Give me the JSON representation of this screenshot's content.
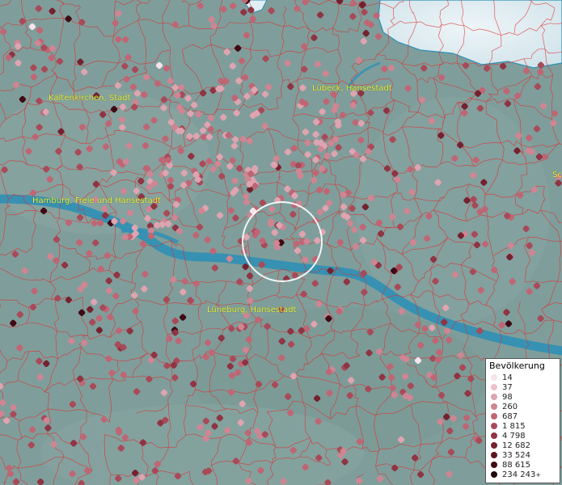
{
  "map": {
    "background": "#7f9e9b",
    "water_color": "#2f8fb5",
    "border_color": "#e02a2a",
    "highlight_ring_color": "#ffffff"
  },
  "labels": {
    "kaltenkirchen": "Kaltenkirchen, Stadt",
    "luebeck": "Lübeck, Hansestadt",
    "hamburg": "Hamburg, Freie und Hansestadt",
    "lueneburg": "Lüneburg, Hansestadt",
    "edge": "Sc"
  },
  "legend": {
    "title": "Bevölkerung",
    "items": [
      {
        "label": "14",
        "color": "#f7e3ea"
      },
      {
        "label": "37",
        "color": "#ecc1cc"
      },
      {
        "label": "98",
        "color": "#dea4b0"
      },
      {
        "label": "260",
        "color": "#cf8592"
      },
      {
        "label": "687",
        "color": "#bf6674"
      },
      {
        "label": "1 815",
        "color": "#a84a58"
      },
      {
        "label": "4 798",
        "color": "#8f3443"
      },
      {
        "label": "12 682",
        "color": "#752230"
      },
      {
        "label": "33 524",
        "color": "#5b1420"
      },
      {
        "label": "88 615",
        "color": "#3f0a13"
      },
      {
        "label": "234 243",
        "color": "#1f0408"
      }
    ],
    "overflow_marker": "+"
  }
}
